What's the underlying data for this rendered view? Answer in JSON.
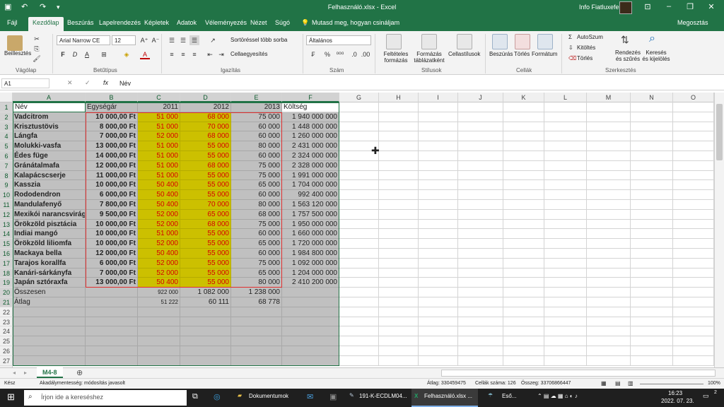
{
  "titlebar": {
    "title": "Felhasználó.xlsx  -  Excel",
    "user": "Info Fiatluxefel",
    "accent": "#217346"
  },
  "menu_tabs": [
    "Fájl",
    "Kezdőlap",
    "Beszúrás",
    "Lapelrendezés",
    "Képletek",
    "Adatok",
    "Véleményezés",
    "Nézet",
    "Súgó"
  ],
  "active_tab": "Kezdőlap",
  "tell_me": "Mutasd meg, hogyan csináljam",
  "share": "Megosztás",
  "ribbon": {
    "paste": "Beillesztés",
    "clipboard": "Vágólap",
    "font_name": "Arial Narrow CE",
    "font_size": "12",
    "font_group": "Betűtípus",
    "bold": "F",
    "italic": "D",
    "underline": "A",
    "wrap": "Sortöréssel több sorba",
    "merge": "Cellaegyesítés",
    "align_group": "Igazítás",
    "number_format": "Általános",
    "number_group": "Szám",
    "cond_fmt": "Feltételes formázás",
    "fmt_table": "Formázás táblázatként",
    "cell_styles": "Cellastílusok",
    "styles_group": "Stílusok",
    "insert": "Beszúrás",
    "delete": "Törlés",
    "format": "Formátum",
    "cells_group": "Cellák",
    "autosum": "AutoSzum",
    "fill": "Kitöltés",
    "clear": "Törlés",
    "sort": "Rendezés és szűrés",
    "find": "Keresés és kijelölés",
    "edit_group": "Szerkesztés"
  },
  "formula_bar": {
    "name_box": "A1",
    "content": "Név"
  },
  "columns": [
    "A",
    "B",
    "C",
    "D",
    "E",
    "F",
    "G",
    "H",
    "I",
    "J",
    "K",
    "L",
    "M",
    "N",
    "O"
  ],
  "headers": [
    "Név",
    "Egységár",
    "2011",
    "2012",
    "2013",
    "Költség"
  ],
  "rows": [
    [
      "Vadcitrom",
      "10 000,00 Ft",
      "51 000",
      "68 000",
      "75 000",
      "1 940 000 000"
    ],
    [
      "Krisztustövis",
      "8 000,00 Ft",
      "51 000",
      "70 000",
      "60 000",
      "1 448 000 000"
    ],
    [
      "Lángfa",
      "7 000,00 Ft",
      "52 000",
      "68 000",
      "60 000",
      "1 260 000 000"
    ],
    [
      "Molukki-vasfa",
      "13 000,00 Ft",
      "51 000",
      "55 000",
      "80 000",
      "2 431 000 000"
    ],
    [
      "Édes füge",
      "14 000,00 Ft",
      "51 000",
      "55 000",
      "60 000",
      "2 324 000 000"
    ],
    [
      "Gránátalmafa",
      "12 000,00 Ft",
      "51 000",
      "68 000",
      "75 000",
      "2 328 000 000"
    ],
    [
      "Kalapácscserje",
      "11 000,00 Ft",
      "51 000",
      "55 000",
      "75 000",
      "1 991 000 000"
    ],
    [
      "Kasszia",
      "10 000,00 Ft",
      "50 400",
      "55 000",
      "65 000",
      "1 704 000 000"
    ],
    [
      "Rododendron",
      "6 000,00 Ft",
      "50 400",
      "55 000",
      "60 000",
      "992 400 000"
    ],
    [
      "Mandulafenyő",
      "7 800,00 Ft",
      "50 400",
      "70 000",
      "80 000",
      "1 563 120 000"
    ],
    [
      "Mexikói narancsvirág",
      "9 500,00 Ft",
      "52 000",
      "65 000",
      "68 000",
      "1 757 500 000"
    ],
    [
      "Örökzöld pisztácia",
      "10 000,00 Ft",
      "52 000",
      "68 000",
      "75 000",
      "1 950 000 000"
    ],
    [
      "Indiai mangó",
      "10 000,00 Ft",
      "51 000",
      "55 000",
      "60 000",
      "1 660 000 000"
    ],
    [
      "Örökzöld liliomfa",
      "10 000,00 Ft",
      "52 000",
      "55 000",
      "65 000",
      "1 720 000 000"
    ],
    [
      "Mackaya bella",
      "12 000,00 Ft",
      "50 400",
      "55 000",
      "60 000",
      "1 984 800 000"
    ],
    [
      "Tarajos korallfa",
      "6 000,00 Ft",
      "52 000",
      "55 000",
      "75 000",
      "1 092 000 000"
    ],
    [
      "Kanári-sárkányfa",
      "7 000,00 Ft",
      "52 000",
      "55 000",
      "65 000",
      "1 204 000 000"
    ],
    [
      "Japán sztóraxfa",
      "13 000,00 Ft",
      "50 400",
      "55 000",
      "80 000",
      "2 410 200 000"
    ]
  ],
  "totals": {
    "label": "Összesen",
    "c": "922 000",
    "d": "1 082 000",
    "e": "1 238 000"
  },
  "averages": {
    "label": "Átlag",
    "c": "51 222",
    "d": "60 111",
    "e": "68 778"
  },
  "sheet_tab": "M4-8",
  "status": {
    "ready": "Kész",
    "accessibility": "Akadálymentesség: módosítás javasolt",
    "average": "Átlag: 330459475",
    "count": "Cellák száma: 126",
    "sum": "Összeg: 33706866447",
    "zoom": "100%"
  },
  "taskbar": {
    "search": "Írjon ide a kereséshez",
    "apps": [
      "Dokumentumok",
      "191-K-ECDLM04...",
      "Felhasználó.xlsx ..."
    ],
    "weather": "Eső...",
    "time": "16:23",
    "date": "2022. 07. 23.",
    "notif": "2"
  }
}
